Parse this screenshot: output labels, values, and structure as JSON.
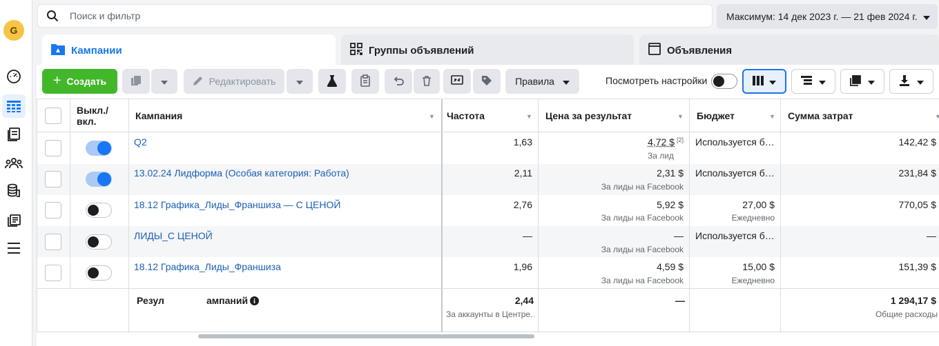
{
  "rail": {
    "avatar_letter": "G"
  },
  "search": {
    "placeholder": "Поиск и фильтр"
  },
  "date_range": {
    "label": "Максимум: 14 дек 2023 г. — 21 фев 2024 г."
  },
  "tabs": [
    {
      "label": "Кампании",
      "active": true
    },
    {
      "label": "Группы объявлений",
      "active": false
    },
    {
      "label": "Объявления",
      "active": false
    }
  ],
  "toolbar": {
    "create_label": "Создать",
    "edit_label": "Редактировать",
    "rules_label": "Правила",
    "view_settings_label": "Посмотреть настройки"
  },
  "colors": {
    "accent": "#1877f2",
    "create_green": "#42b72a",
    "link": "#1b5fb5"
  },
  "table": {
    "headers": {
      "onoff": "Выкл./\nвкл.",
      "campaign": "Кампания",
      "frequency": "Частота",
      "cost": "Цена за результат",
      "budget": "Бюджет",
      "spend": "Сумма затрат"
    },
    "rows": [
      {
        "on": true,
        "name": "Q2",
        "frequency": "1,63",
        "cost": "4,72 $",
        "cost_note": "[2]",
        "cost_sub": "За лид",
        "budget": "Используется б…",
        "budget_sub": "",
        "spend": "142,42 $"
      },
      {
        "on": true,
        "name": "13.02.24 Лидформа (Особая категория: Работа)",
        "frequency": "2,11",
        "cost": "2,31 $",
        "cost_note": "",
        "cost_sub": "За лиды на Facebook",
        "budget": "Используется б…",
        "budget_sub": "",
        "spend": "231,84 $"
      },
      {
        "on": false,
        "name": "18.12 Графика_Лиды_Франшиза — С ЦЕНОЙ",
        "frequency": "2,76",
        "cost": "5,92 $",
        "cost_note": "",
        "cost_sub": "За лиды на Facebook",
        "budget": "27,00 $",
        "budget_sub": "Ежедневно",
        "spend": "770,05 $"
      },
      {
        "on": false,
        "name": "ЛИДЫ_С ЦЕНОЙ",
        "frequency": "—",
        "cost": "—",
        "cost_note": "",
        "cost_sub": "За лиды на Facebook",
        "budget": "Используется б…",
        "budget_sub": "",
        "spend": "—"
      },
      {
        "on": false,
        "name": "18.12 Графика_Лиды_Франшиза",
        "frequency": "1,96",
        "cost": "4,59 $",
        "cost_note": "",
        "cost_sub": "За лиды на Facebook",
        "budget": "15,00 $",
        "budget_sub": "Ежедневно",
        "spend": "151,39 $"
      }
    ],
    "summary": {
      "label_left": "Резул",
      "label_right": "ампаний",
      "frequency": "2,44",
      "frequency_sub": "За аккаунты в Центре…",
      "cost": "—",
      "spend": "1 294,17 $",
      "spend_sub": "Общие расходы"
    }
  }
}
